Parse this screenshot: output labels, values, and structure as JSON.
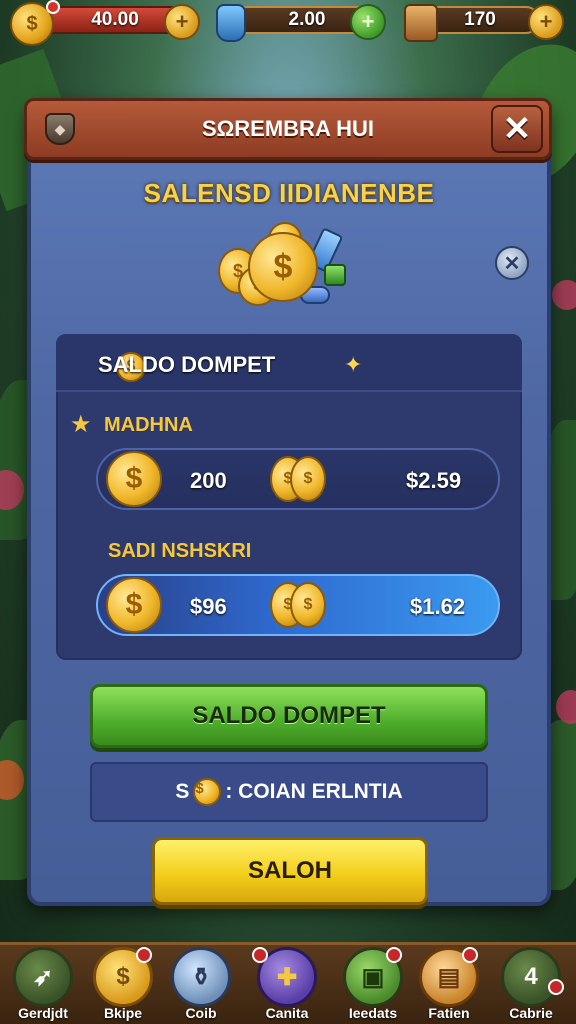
{
  "top_bar": {
    "coins": "40.00",
    "potions": "2.00",
    "gems": "170"
  },
  "panel": {
    "title": "SΩREMBRA HUI",
    "subtitle": "SALENSD IIDIANENBE"
  },
  "wallet": {
    "header_label": "SALDO DOMPET",
    "section1_label": "MADHNA",
    "section2_label": "SADI NSHSKRI",
    "rows": [
      {
        "amount": "200",
        "price": "$2.59"
      },
      {
        "amount": "$96",
        "price": "$1.62"
      }
    ]
  },
  "buttons": {
    "primary": "SALDO DOMPET",
    "info_prefix": "S",
    "info_suffix": ": COIAN ERLNTIA",
    "confirm": "SALOH"
  },
  "nav": [
    {
      "label": "Gerdjdt",
      "icon": "map-icon"
    },
    {
      "label": "Bkipe",
      "icon": "coin-icon"
    },
    {
      "label": "Coib",
      "icon": "potion-icon"
    },
    {
      "label": "Canita",
      "icon": "cross-icon"
    },
    {
      "label": "Ieedats",
      "icon": "chest-icon"
    },
    {
      "label": "Fatien",
      "icon": "scroll-icon"
    },
    {
      "label": "Cabrie",
      "icon": "profile-icon"
    }
  ],
  "colors": {
    "panel": "#4e67a3",
    "header": "#8d3c24",
    "primary_button": "#4eae2c",
    "confirm_button": "#f3cf1c",
    "accent_gold": "#f5c842"
  }
}
